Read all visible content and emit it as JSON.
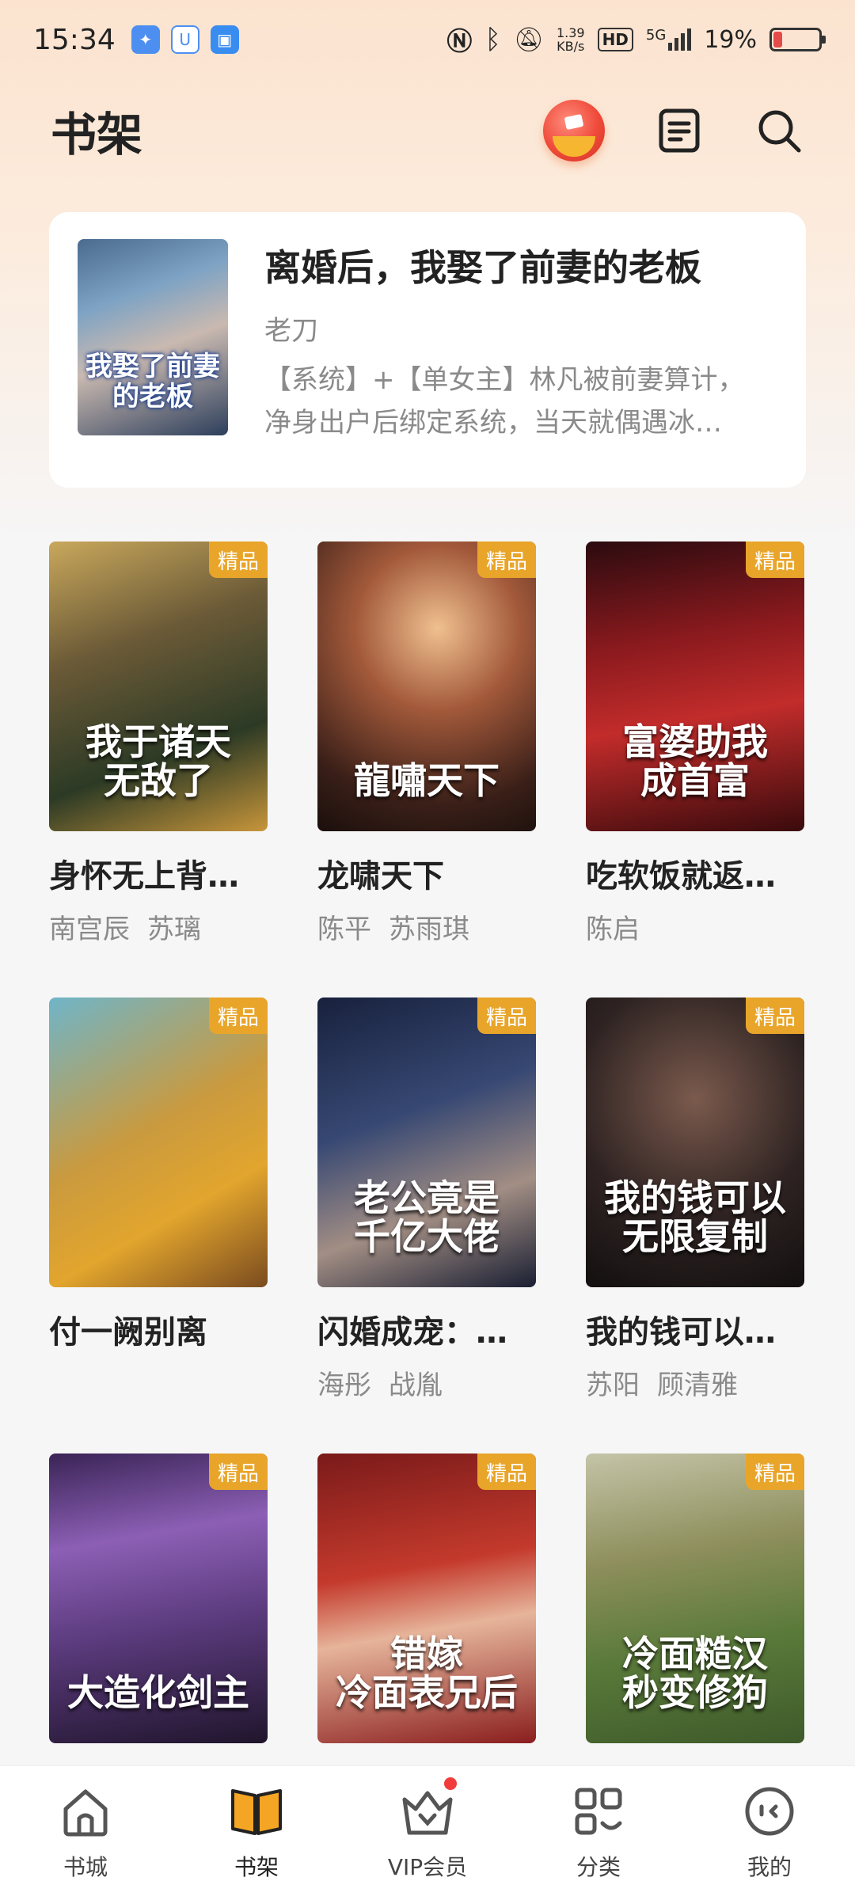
{
  "status_bar": {
    "time": "15:34",
    "net_speed_value": "1.39",
    "net_speed_unit": "KB/s",
    "hd": "HD",
    "signal": "5G",
    "battery": "19%",
    "battery_level": 0.19
  },
  "header": {
    "title": "书架"
  },
  "featured": {
    "title": "离婚后，我娶了前妻的老板",
    "author": "老刀",
    "description": "【系统】+【单女主】林凡被前妻算计，净身出户后绑定系统，当天就偶遇冰…"
  },
  "books": [
    {
      "title": "身怀无上背…",
      "authors": [
        "南宫辰",
        "苏璃"
      ],
      "badge": "精品"
    },
    {
      "title": "龙啸天下",
      "authors": [
        "陈平",
        "苏雨琪"
      ],
      "badge": "精品"
    },
    {
      "title": "吃软饭就返…",
      "authors": [
        "陈启"
      ],
      "badge": "精品"
    },
    {
      "title": "付一阙别离",
      "authors": [],
      "badge": "精品"
    },
    {
      "title": "闪婚成宠：…",
      "authors": [
        "海彤",
        "战胤"
      ],
      "badge": "精品"
    },
    {
      "title": "我的钱可以…",
      "authors": [
        "苏阳",
        "顾清雅"
      ],
      "badge": "精品"
    },
    {
      "title": "",
      "authors": [],
      "badge": "精品"
    },
    {
      "title": "",
      "authors": [],
      "badge": "精品"
    },
    {
      "title": "",
      "authors": [],
      "badge": "精品"
    }
  ],
  "tabs": [
    {
      "label": "书城",
      "icon": "home-icon"
    },
    {
      "label": "书架",
      "icon": "bookshelf-icon",
      "active": true
    },
    {
      "label": "VIP会员",
      "icon": "vip-crown-icon"
    },
    {
      "label": "分类",
      "icon": "category-icon"
    },
    {
      "label": "我的",
      "icon": "profile-icon"
    }
  ],
  "colors": {
    "accent": "#e8a52a",
    "badge": "#e8a52a",
    "notification_dot": "#f23b3b"
  }
}
